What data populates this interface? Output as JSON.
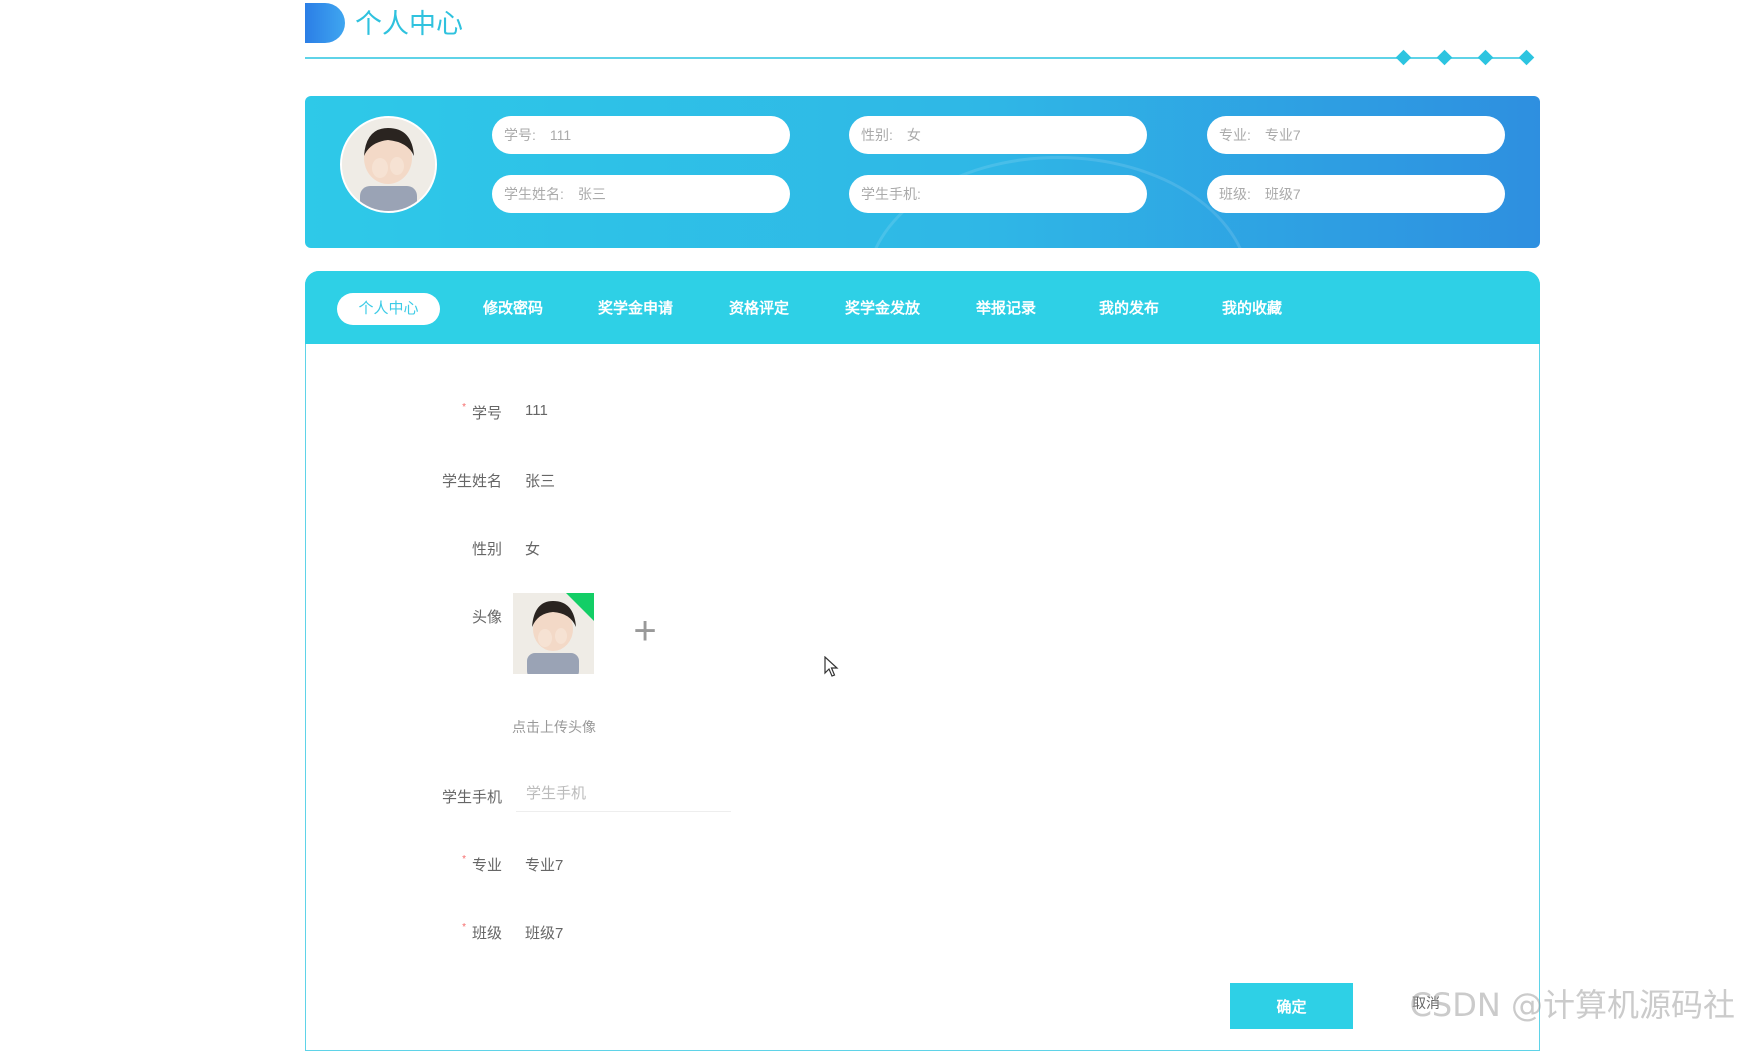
{
  "page": {
    "title": "个人中心"
  },
  "profile": {
    "fields": [
      {
        "label": "学号:",
        "value": "111"
      },
      {
        "label": "性别:",
        "value": "女"
      },
      {
        "label": "专业:",
        "value": "专业7"
      },
      {
        "label": "学生姓名:",
        "value": "张三"
      },
      {
        "label": "学生手机:",
        "value": ""
      },
      {
        "label": "班级:",
        "value": "班级7"
      }
    ]
  },
  "tabs": [
    {
      "label": "个人中心",
      "active": true
    },
    {
      "label": "修改密码"
    },
    {
      "label": "奖学金申请"
    },
    {
      "label": "资格评定"
    },
    {
      "label": "奖学金发放"
    },
    {
      "label": "举报记录"
    },
    {
      "label": "我的发布"
    },
    {
      "label": "我的收藏"
    }
  ],
  "form": {
    "student_no": {
      "label": "学号",
      "value": "111",
      "required": true
    },
    "student_name": {
      "label": "学生姓名",
      "value": "张三"
    },
    "gender": {
      "label": "性别",
      "value": "女"
    },
    "avatar": {
      "label": "头像",
      "hint": "点击上传头像"
    },
    "phone": {
      "label": "学生手机",
      "value": "",
      "placeholder": "学生手机"
    },
    "major": {
      "label": "专业",
      "value": "专业7",
      "required": true
    },
    "class": {
      "label": "班级",
      "value": "班级7",
      "required": true
    }
  },
  "actions": {
    "confirm": "确定",
    "cancel": "取消"
  },
  "watermark": "CSDN @计算机源码社",
  "colors": {
    "accent": "#2ed0e6",
    "banner_start": "#2ec9e8",
    "banner_end": "#2e8fe0",
    "required": "#f56c6c",
    "upload_success": "#13ce66"
  }
}
